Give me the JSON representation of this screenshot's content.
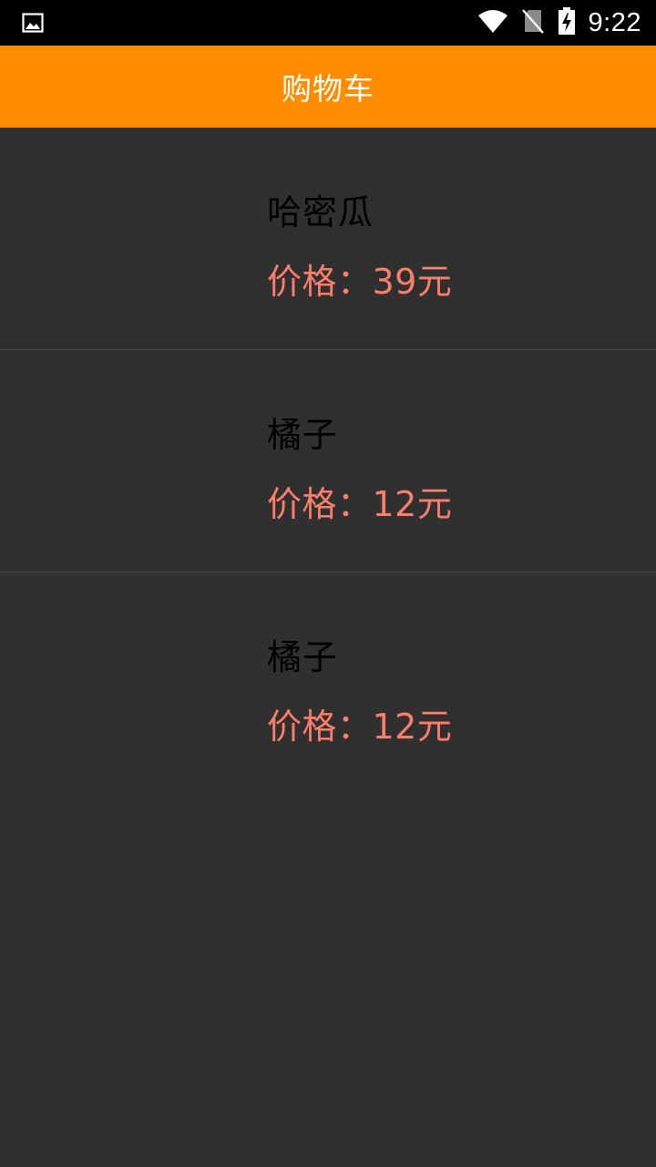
{
  "status_bar": {
    "time": "9:22",
    "icons": [
      "image-notification-icon",
      "wifi-icon",
      "no-sim-icon",
      "battery-charging-icon"
    ]
  },
  "app_bar": {
    "title": "购物车"
  },
  "cart": {
    "items": [
      {
        "name": "哈密瓜",
        "price": "价格：39元"
      },
      {
        "name": "橘子",
        "price": "价格：12元"
      },
      {
        "name": "橘子",
        "price": "价格：12元"
      }
    ]
  },
  "colors": {
    "app_bar": "#ff8c00",
    "background": "#303030",
    "price_text": "#fa7e6a",
    "name_text": "#000000"
  }
}
